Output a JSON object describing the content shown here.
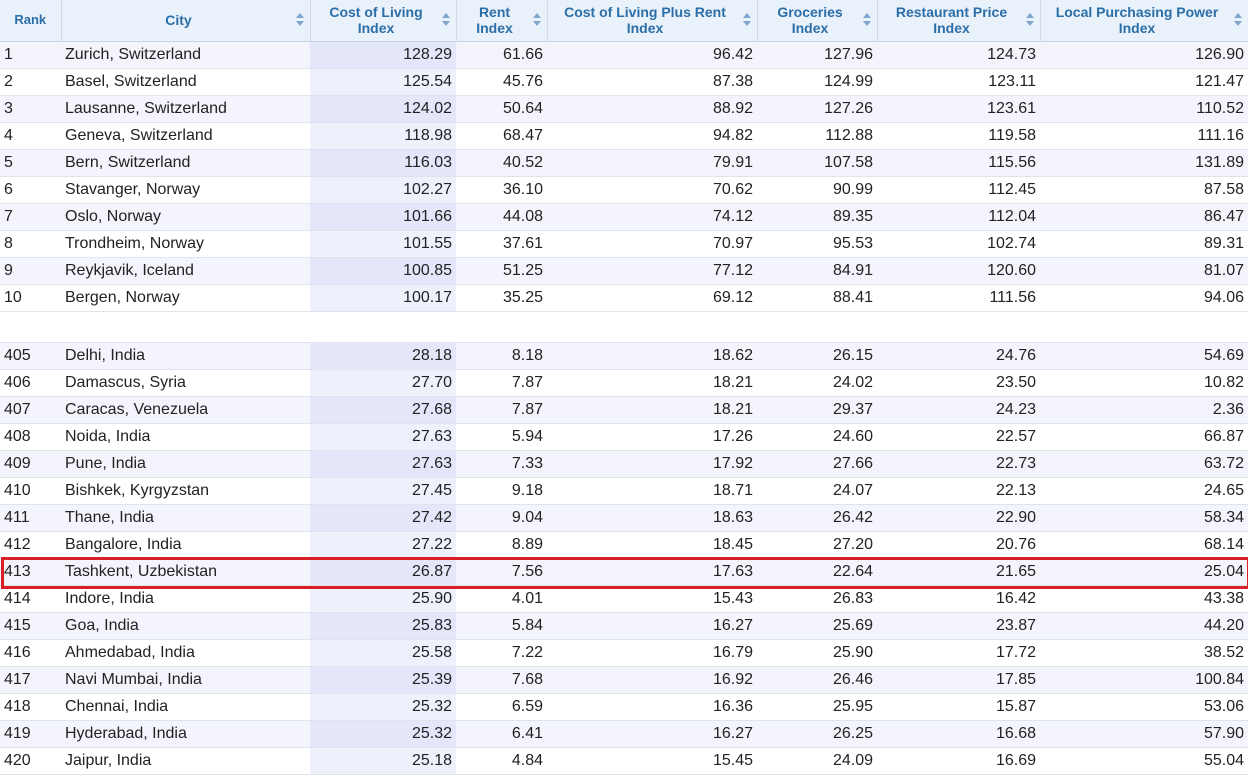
{
  "columns": [
    {
      "label": "Rank",
      "sortable": false
    },
    {
      "label": "City",
      "sortable": true
    },
    {
      "label": "Cost of Living Index",
      "sortable": true
    },
    {
      "label": "Rent Index",
      "sortable": true
    },
    {
      "label": "Cost of Living Plus Rent Index",
      "sortable": true
    },
    {
      "label": "Groceries Index",
      "sortable": true
    },
    {
      "label": "Restaurant Price Index",
      "sortable": true
    },
    {
      "label": "Local Purchasing Power Index",
      "sortable": true
    }
  ],
  "top_rows": [
    [
      "1",
      "Zurich, Switzerland",
      "128.29",
      "61.66",
      "96.42",
      "127.96",
      "124.73",
      "126.90"
    ],
    [
      "2",
      "Basel, Switzerland",
      "125.54",
      "45.76",
      "87.38",
      "124.99",
      "123.11",
      "121.47"
    ],
    [
      "3",
      "Lausanne, Switzerland",
      "124.02",
      "50.64",
      "88.92",
      "127.26",
      "123.61",
      "110.52"
    ],
    [
      "4",
      "Geneva, Switzerland",
      "118.98",
      "68.47",
      "94.82",
      "112.88",
      "119.58",
      "111.16"
    ],
    [
      "5",
      "Bern, Switzerland",
      "116.03",
      "40.52",
      "79.91",
      "107.58",
      "115.56",
      "131.89"
    ],
    [
      "6",
      "Stavanger, Norway",
      "102.27",
      "36.10",
      "70.62",
      "90.99",
      "112.45",
      "87.58"
    ],
    [
      "7",
      "Oslo, Norway",
      "101.66",
      "44.08",
      "74.12",
      "89.35",
      "112.04",
      "86.47"
    ],
    [
      "8",
      "Trondheim, Norway",
      "101.55",
      "37.61",
      "70.97",
      "95.53",
      "102.74",
      "89.31"
    ],
    [
      "9",
      "Reykjavik, Iceland",
      "100.85",
      "51.25",
      "77.12",
      "84.91",
      "120.60",
      "81.07"
    ],
    [
      "10",
      "Bergen, Norway",
      "100.17",
      "35.25",
      "69.12",
      "88.41",
      "111.56",
      "94.06"
    ]
  ],
  "bottom_rows": [
    [
      "405",
      "Delhi, India",
      "28.18",
      "8.18",
      "18.62",
      "26.15",
      "24.76",
      "54.69"
    ],
    [
      "406",
      "Damascus, Syria",
      "27.70",
      "7.87",
      "18.21",
      "24.02",
      "23.50",
      "10.82"
    ],
    [
      "407",
      "Caracas, Venezuela",
      "27.68",
      "7.87",
      "18.21",
      "29.37",
      "24.23",
      "2.36"
    ],
    [
      "408",
      "Noida, India",
      "27.63",
      "5.94",
      "17.26",
      "24.60",
      "22.57",
      "66.87"
    ],
    [
      "409",
      "Pune, India",
      "27.63",
      "7.33",
      "17.92",
      "27.66",
      "22.73",
      "63.72"
    ],
    [
      "410",
      "Bishkek, Kyrgyzstan",
      "27.45",
      "9.18",
      "18.71",
      "24.07",
      "22.13",
      "24.65"
    ],
    [
      "411",
      "Thane, India",
      "27.42",
      "9.04",
      "18.63",
      "26.42",
      "22.90",
      "58.34"
    ],
    [
      "412",
      "Bangalore, India",
      "27.22",
      "8.89",
      "18.45",
      "27.20",
      "20.76",
      "68.14"
    ],
    [
      "413",
      "Tashkent, Uzbekistan",
      "26.87",
      "7.56",
      "17.63",
      "22.64",
      "21.65",
      "25.04"
    ],
    [
      "414",
      "Indore, India",
      "25.90",
      "4.01",
      "15.43",
      "26.83",
      "16.42",
      "43.38"
    ],
    [
      "415",
      "Goa, India",
      "25.83",
      "5.84",
      "16.27",
      "25.69",
      "23.87",
      "44.20"
    ],
    [
      "416",
      "Ahmedabad, India",
      "25.58",
      "7.22",
      "16.79",
      "25.90",
      "17.72",
      "38.52"
    ],
    [
      "417",
      "Navi Mumbai, India",
      "25.39",
      "7.68",
      "16.92",
      "26.46",
      "17.85",
      "100.84"
    ],
    [
      "418",
      "Chennai, India",
      "25.32",
      "6.59",
      "16.36",
      "25.95",
      "15.87",
      "53.06"
    ],
    [
      "419",
      "Hyderabad, India",
      "25.32",
      "6.41",
      "16.27",
      "26.25",
      "16.68",
      "57.90"
    ],
    [
      "420",
      "Jaipur, India",
      "25.18",
      "4.84",
      "15.45",
      "24.09",
      "16.69",
      "55.04"
    ]
  ],
  "highlight": {
    "rank": "413",
    "color": "#d9202a"
  },
  "colors": {
    "header_bg": "#e9f1fa",
    "header_text": "#2b6ea8",
    "row_alt": "#f4f4fc",
    "sorted_col": "#e4e6fa"
  }
}
